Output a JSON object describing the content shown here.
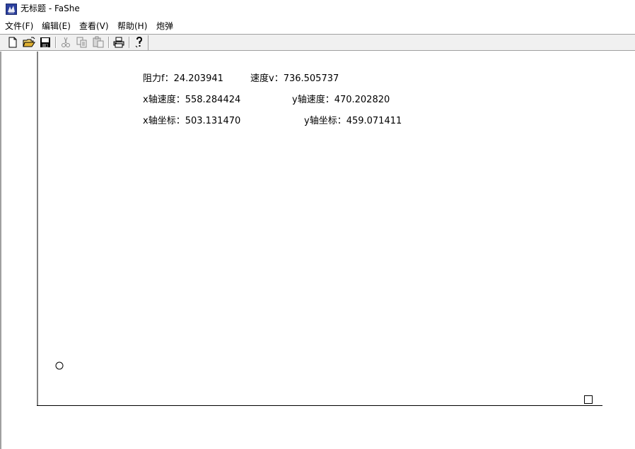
{
  "window": {
    "title": "无标题 - FaShe"
  },
  "menu": {
    "items": [
      "文件(F)",
      "编辑(E)",
      "查看(V)",
      "帮助(H)",
      "炮弹"
    ]
  },
  "toolbar": {
    "buttons": [
      {
        "icon": "new-file-icon"
      },
      {
        "icon": "open-folder-icon"
      },
      {
        "icon": "save-disk-icon"
      },
      {
        "icon": "cut-icon"
      },
      {
        "icon": "copy-icon"
      },
      {
        "icon": "paste-icon"
      },
      {
        "icon": "print-icon"
      },
      {
        "icon": "help-icon"
      }
    ]
  },
  "readouts": {
    "resistance": "阻力f：24.203941",
    "velocity": "速度v：736.505737",
    "x_velocity": "x轴速度：558.284424",
    "y_velocity": "y轴速度：470.202820",
    "x_coordinate": "x轴坐标：503.131470",
    "y_coordinate": "y轴坐标：459.071411"
  },
  "scene": {
    "projectile": "circle",
    "target": "square",
    "axis_color": "#000000"
  }
}
